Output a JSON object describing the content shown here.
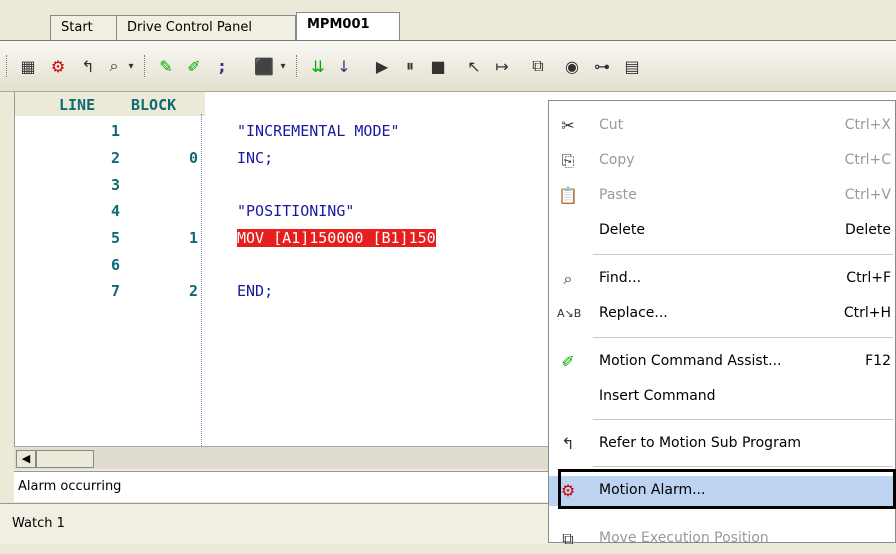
{
  "tabs": [
    {
      "label": "Start",
      "active": false
    },
    {
      "label": "Drive Control Panel",
      "active": false
    },
    {
      "label": "MPM001",
      "active": true
    }
  ],
  "toolbar_icons": [
    "table-icon",
    "alarm-icon",
    "refer-subprogram-icon",
    "search-icon",
    "dropdown-arrow-icon",
    "edit-icon",
    "motion-assist-icon",
    "semicolon-icon",
    "step-icon",
    "dropdown-arrow-icon",
    "step-in-icon",
    "step-down-icon",
    "play-icon",
    "pause-icon",
    "stop-icon",
    "cursor-icon",
    "jump-icon",
    "box-icon",
    "breakpoint-icon",
    "connect-icon",
    "grid-icon"
  ],
  "editor": {
    "header_line": "LINE",
    "header_block": "BLOCK",
    "rows": [
      {
        "line": "1",
        "block": "",
        "text": "\"INCREMENTAL MODE\"",
        "highlight": false
      },
      {
        "line": "2",
        "block": "0",
        "text": "INC;",
        "highlight": false
      },
      {
        "line": "3",
        "block": "",
        "text": "",
        "highlight": false
      },
      {
        "line": "4",
        "block": "",
        "text": "\"POSITIONING\"",
        "highlight": false
      },
      {
        "line": "5",
        "block": "1",
        "text": "MOV [A1]150000 [B1]150",
        "highlight": true
      },
      {
        "line": "6",
        "block": "",
        "text": "",
        "highlight": false
      },
      {
        "line": "7",
        "block": "2",
        "text": "END;",
        "highlight": false
      }
    ]
  },
  "status": {
    "text": "Alarm occurring"
  },
  "watch": {
    "label": "Watch 1"
  },
  "context_menu": {
    "items": [
      {
        "icon": "scissors-icon",
        "label": "Cut",
        "shortcut": "Ctrl+X",
        "disabled": true
      },
      {
        "icon": "copy-icon",
        "label": "Copy",
        "shortcut": "Ctrl+C",
        "disabled": true
      },
      {
        "icon": "paste-icon",
        "label": "Paste",
        "shortcut": "Ctrl+V",
        "disabled": true
      },
      {
        "icon": "",
        "label": "Delete",
        "shortcut": "Delete",
        "disabled": false
      },
      {
        "icon": "binoculars-icon",
        "label": "Find...",
        "shortcut": "Ctrl+F",
        "disabled": false
      },
      {
        "icon": "replace-icon",
        "label": "Replace...",
        "shortcut": "Ctrl+H",
        "disabled": false
      },
      {
        "icon": "motion-assist-icon",
        "label": "Motion Command Assist...",
        "shortcut": "F12",
        "disabled": false
      },
      {
        "icon": "",
        "label": "Insert Command",
        "shortcut": "",
        "disabled": false
      },
      {
        "icon": "refer-subprogram-icon",
        "label": "Refer to Motion Sub Program",
        "shortcut": "",
        "disabled": false
      },
      {
        "icon": "alarm-icon",
        "label": "Motion Alarm...",
        "shortcut": "",
        "disabled": false,
        "selected": true
      },
      {
        "icon": "move-execution-icon",
        "label": "Move Execution Position",
        "shortcut": "",
        "disabled": true
      }
    ]
  }
}
